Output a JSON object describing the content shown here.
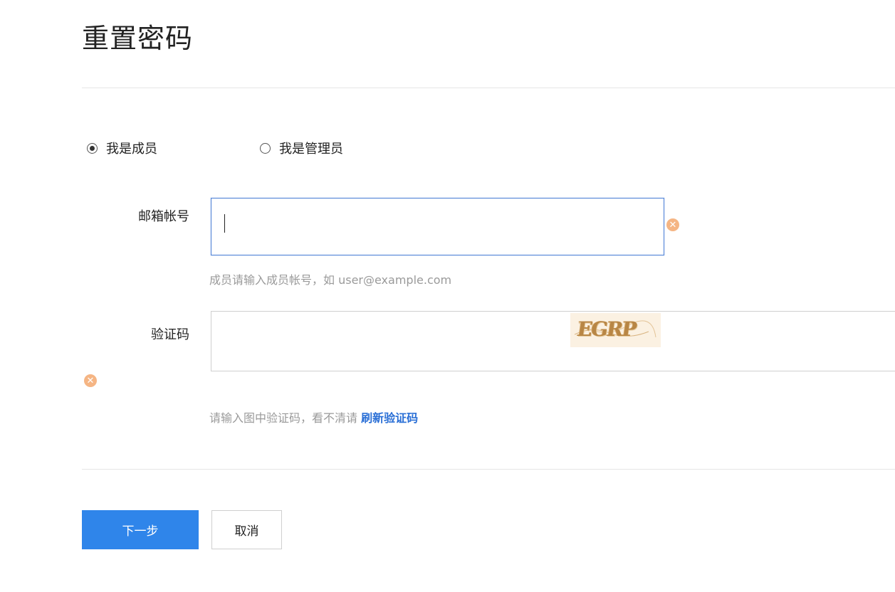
{
  "page": {
    "title": "重置密码"
  },
  "roles": {
    "member_label": "我是成员",
    "admin_label": "我是管理员",
    "selected": "member"
  },
  "email": {
    "label": "邮箱帐号",
    "value": "",
    "hint": "成员请输入成员帐号，如 user@example.com"
  },
  "captcha": {
    "label": "验证码",
    "value": "",
    "image_text": "EGRP",
    "hint_prefix": "请输入图中验证码，看不清请 ",
    "refresh_link": "刷新验证码"
  },
  "actions": {
    "next_label": "下一步",
    "cancel_label": "取消"
  },
  "colors": {
    "primary": "#2f85ea",
    "link": "#2a6fd6",
    "focus_border": "#4a7fd6",
    "error_icon": "#f5b584",
    "hint_text": "#9a9a9a"
  },
  "icons": {
    "clear": "clear-icon"
  }
}
